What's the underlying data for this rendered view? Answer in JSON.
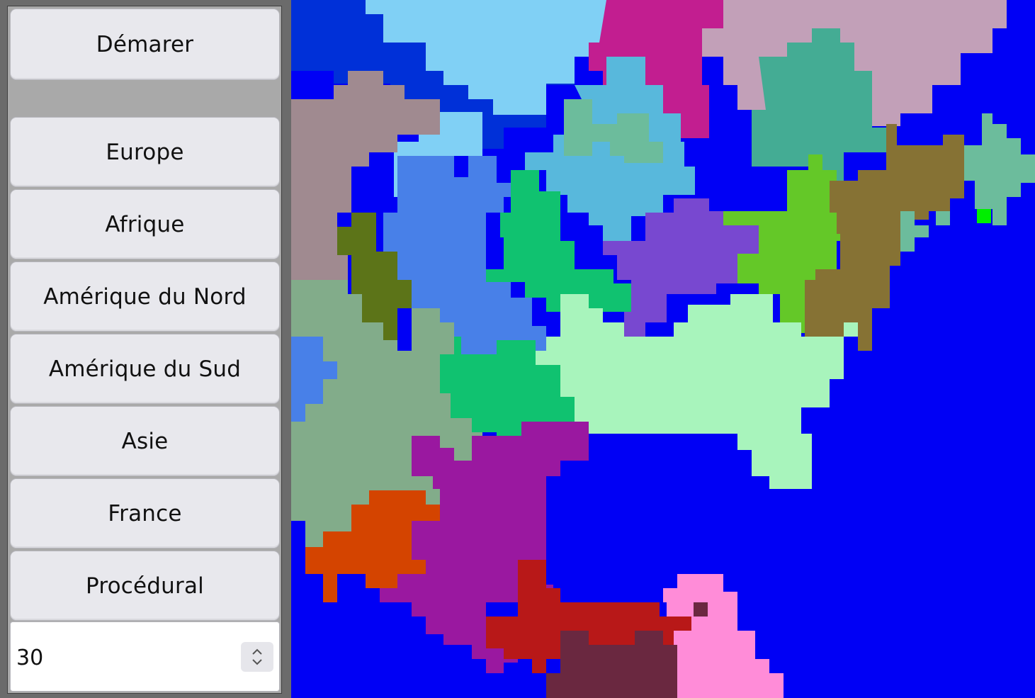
{
  "sidebar": {
    "start_label": "Démarer",
    "buttons": [
      "Europe",
      "Afrique",
      "Amérique du Nord",
      "Amérique du Sud",
      "Asie",
      "France",
      "Procédural"
    ],
    "spin_value": "30"
  },
  "map": {
    "ocean_color": "#0000f5",
    "regions": [
      {
        "name": "light-blue-north",
        "color": "#80d0f5"
      },
      {
        "name": "dark-blue-northwest",
        "color": "#0030d8"
      },
      {
        "name": "magenta-north",
        "color": "#c21e90"
      },
      {
        "name": "pink-beige-northeast",
        "color": "#c2a0b8"
      },
      {
        "name": "teal-northeast",
        "color": "#44ac94"
      },
      {
        "name": "mauve-west",
        "color": "#a08a90"
      },
      {
        "name": "sky-blue-center",
        "color": "#58b8dc"
      },
      {
        "name": "cerulean-west",
        "color": "#4880e8"
      },
      {
        "name": "dark-olive-west",
        "color": "#5c7418"
      },
      {
        "name": "emerald-center",
        "color": "#10c270"
      },
      {
        "name": "purple-center",
        "color": "#7848d0"
      },
      {
        "name": "lime-east",
        "color": "#64c828"
      },
      {
        "name": "brown-olive-east",
        "color": "#867234"
      },
      {
        "name": "sea-green-east",
        "color": "#6cbc9c"
      },
      {
        "name": "mint-center",
        "color": "#a8f4bc"
      },
      {
        "name": "sage-southwest",
        "color": "#82ac8a"
      },
      {
        "name": "violet-south",
        "color": "#9a18a0"
      },
      {
        "name": "orange-southwest",
        "color": "#d44400"
      },
      {
        "name": "crimson-south",
        "color": "#b81818"
      },
      {
        "name": "pink-south",
        "color": "#ff8cd8"
      },
      {
        "name": "maroon-south",
        "color": "#6a2840"
      },
      {
        "name": "green-dot",
        "color": "#00ee00"
      }
    ]
  }
}
